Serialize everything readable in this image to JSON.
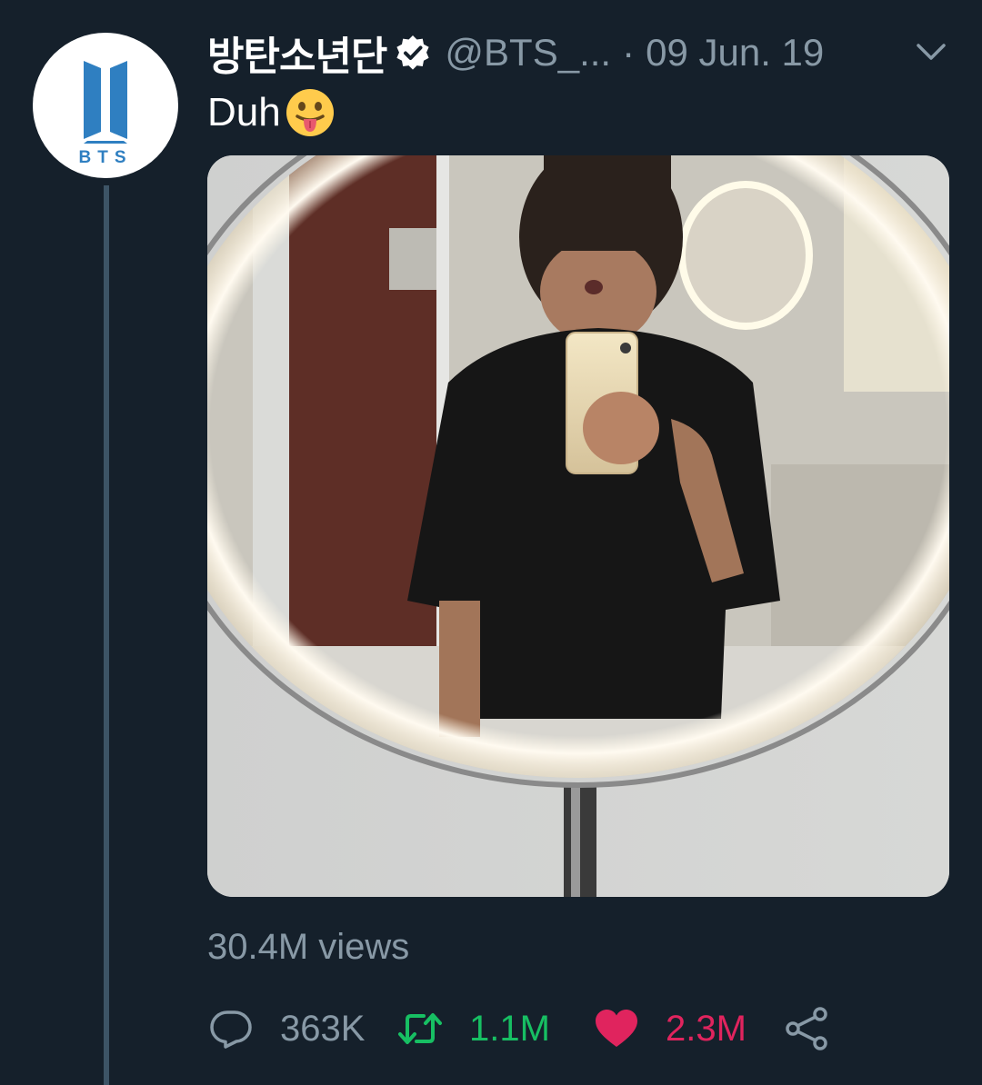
{
  "tweet": {
    "display_name": "방탄소년단",
    "handle": "@BTS_...",
    "separator": "·",
    "date": "09 Jun. 19",
    "text": "Duh",
    "views": "30.4M views",
    "avatar_text": "BTS"
  },
  "actions": {
    "reply_count": "363K",
    "retweet_count": "1.1M",
    "like_count": "2.3M"
  },
  "icons": {
    "verified": "verified-badge-icon",
    "caret": "chevron-down-icon",
    "reply": "reply-icon",
    "retweet": "retweet-icon",
    "like": "heart-icon",
    "share": "share-icon",
    "emoji": "tongue-emoji"
  },
  "colors": {
    "background": "#15202b",
    "secondary_text": "#8899a6",
    "retweet": "#17bf63",
    "like": "#e0245e",
    "bts_logo": "#2f7fc1"
  }
}
